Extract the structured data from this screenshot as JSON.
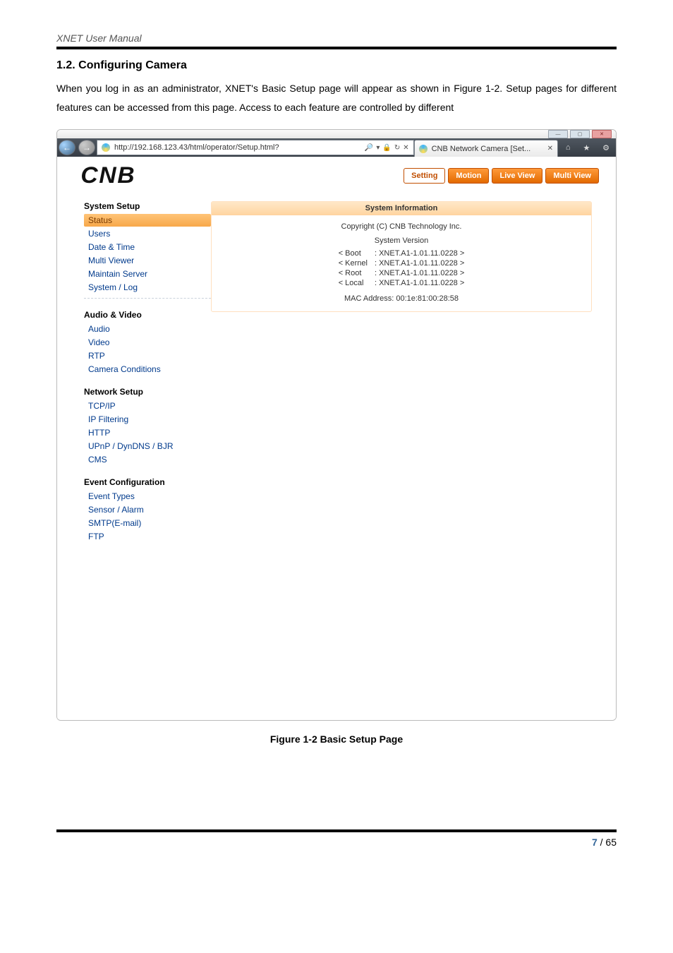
{
  "doc_header": "XNET User Manual",
  "section_title": "1.2. Configuring Camera",
  "body_text": "When you log in as an administrator, XNET's Basic Setup page will appear as shown in Figure 1-2. Setup pages for different features can be accessed from this page. Access to each feature are controlled by different",
  "figure_caption": "Figure 1-2 Basic Setup Page",
  "page_number_current": "7",
  "page_number_total": "65",
  "page_sep": " / ",
  "browser": {
    "url_text": "http://192.168.123.43/html/operator/Setup.html?",
    "search_glyph": "🔎",
    "dropdown_glyph": "▾",
    "cert_glyph": "🔒",
    "refresh_glyph": "↻",
    "stop_glyph": "✕",
    "tab_title": "CNB Network Camera [Set...",
    "tab_close": "✕",
    "win_btn_min": "—",
    "win_btn_max": "▢",
    "win_btn_close": "✕",
    "back_glyph": "←",
    "fwd_glyph": "→",
    "home_glyph": "⌂",
    "star_glyph": "★",
    "gear_glyph": "⚙"
  },
  "cnb": {
    "logo_c": "C",
    "logo_n": "N",
    "logo_b": "B",
    "nav": {
      "setting": "Setting",
      "motion": "Motion",
      "live": "Live View",
      "multi": "Multi View"
    },
    "sidebar": {
      "g1": "System Setup",
      "g1_items": {
        "status": "Status",
        "users": "Users",
        "datetime": "Date & Time",
        "multiviewer": "Multi Viewer",
        "maintain": "Maintain Server",
        "syslog": "System / Log"
      },
      "g2": "Audio & Video",
      "g2_items": {
        "audio": "Audio",
        "video": "Video",
        "rtp": "RTP",
        "cameracond": "Camera Conditions"
      },
      "g3": "Network Setup",
      "g3_items": {
        "tcpip": "TCP/IP",
        "ipfilter": "IP Filtering",
        "http": "HTTP",
        "upnp": "UPnP / DynDNS / BJR",
        "cms": "CMS"
      },
      "g4": "Event Configuration",
      "g4_items": {
        "eventtypes": "Event Types",
        "sensor": "Sensor / Alarm",
        "smtp": "SMTP(E-mail)",
        "ftp": "FTP"
      }
    },
    "panel": {
      "title": "System Information",
      "copyright": "Copyright (C) CNB Technology Inc.",
      "sysver_label": "System Version",
      "rows": [
        {
          "k": "< Boot",
          "v": ": XNET.A1-1.01.11.0228 >"
        },
        {
          "k": "< Kernel",
          "v": ": XNET.A1-1.01.11.0228 >"
        },
        {
          "k": "< Root",
          "v": ": XNET.A1-1.01.11.0228 >"
        },
        {
          "k": "< Local",
          "v": ": XNET.A1-1.01.11.0228 >"
        }
      ],
      "mac": "MAC Address: 00:1e:81:00:28:58"
    }
  }
}
